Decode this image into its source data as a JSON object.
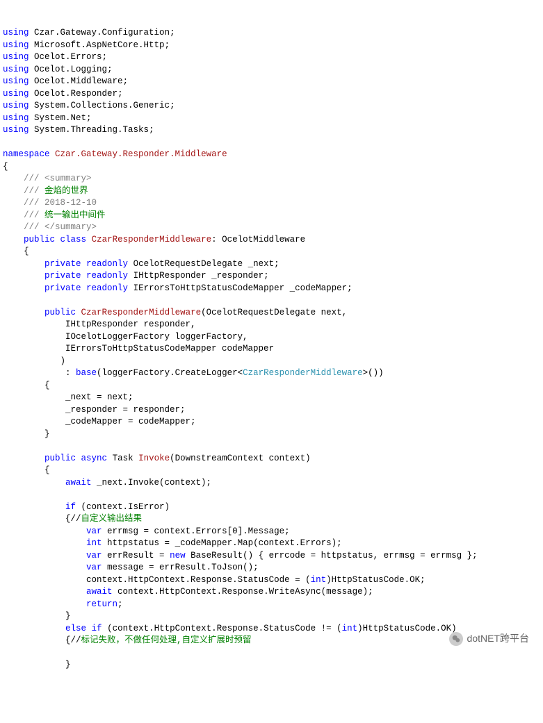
{
  "usings": [
    "Czar.Gateway.Configuration",
    "Microsoft.AspNetCore.Http",
    "Ocelot.Errors",
    "Ocelot.Logging",
    "Ocelot.Middleware",
    "Ocelot.Responder",
    "System.Collections.Generic",
    "System.Net",
    "System.Threading.Tasks"
  ],
  "kw": {
    "using": "using",
    "namespace": "namespace",
    "public": "public",
    "class": "class",
    "private": "private",
    "readonly": "readonly",
    "base": "base",
    "async": "async",
    "await": "await",
    "if": "if",
    "else": "else",
    "var": "var",
    "int": "int",
    "new": "new",
    "return": "return"
  },
  "namespace": "Czar.Gateway.Responder.Middleware",
  "summary": {
    "open": "/// <summary>",
    "line1": "/// ",
    "line1green": "金焰的世界",
    "line2": "/// 2018-12-10",
    "line3": "/// ",
    "line3green": "统一输出中间件",
    "close": "/// </summary>"
  },
  "classDecl": {
    "name": "CzarResponderMiddleware",
    "base": "OcelotMiddleware"
  },
  "fields": {
    "f1type": "OcelotRequestDelegate",
    "f1name": " _next;",
    "f2type": "IHttpResponder",
    "f2name": " _responder;",
    "f3type": "IErrorsToHttpStatusCodeMapper",
    "f3name": " _codeMapper;"
  },
  "ctor": {
    "name": "CzarResponderMiddleware",
    "p1": "(OcelotRequestDelegate next,",
    "p2": "IHttpResponder responder,",
    "p3": "IOcelotLoggerFactory loggerFactory,",
    "p4": "IErrorsToHttpStatusCodeMapper codeMapper",
    "close": ")",
    "baseCall1": "(loggerFactory.CreateLogger<",
    "baseGeneric": "CzarResponderMiddleware",
    "baseCall2": ">())",
    "b1": "_next = next;",
    "b2": "_responder = responder;",
    "b3": "_codeMapper = codeMapper;"
  },
  "invoke": {
    "ret": "Task",
    "name": "Invoke",
    "params": "(DownstreamContext context)",
    "l1": " _next.Invoke(context);",
    "l2": " (context.IsError)",
    "cmt1": "{//",
    "cmt1green": "自定义输出结果",
    "l3": " errmsg = context.Errors[",
    "l3num": "0",
    "l3tail": "].Message;",
    "l4": " httpstatus = _codeMapper.Map(context.Errors);",
    "l5": " errResult = ",
    "l5b": " BaseResult() { errcode = httpstatus, errmsg = errmsg };",
    "l6": " message = errResult.ToJson();",
    "l7": "context.HttpContext.Response.StatusCode = (",
    "l7cast": "int",
    "l7tail": ")HttpStatusCode.OK;",
    "l8": " context.HttpContext.Response.WriteAsync(message);",
    "l9": ";",
    "l10": " (context.HttpContext.Response.StatusCode != (",
    "l10cast": "int",
    "l10tail": ")HttpStatusCode.OK)",
    "cmt2": "{//",
    "cmt2green": "标记失败，不做任何处理,自定义扩展时预留"
  },
  "braces": {
    "open": "{",
    "close": "}"
  },
  "punct": {
    "colon": ": ",
    "colonbase": ": ",
    "semi": ";",
    "space": " "
  },
  "watermark": "dotNET跨平台"
}
